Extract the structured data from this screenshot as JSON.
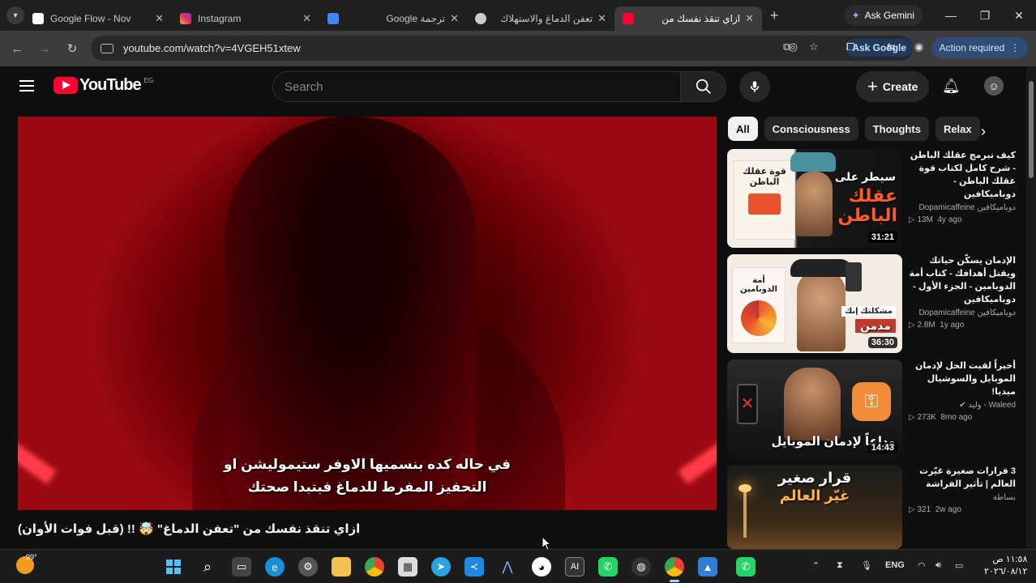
{
  "browser": {
    "tabs": [
      {
        "title": "Google Flow - Nov",
        "color": "#4285f4"
      },
      {
        "title": "Instagram",
        "color": "#e1306c"
      },
      {
        "title": "Google ترجمة",
        "color": "#4285f4"
      },
      {
        "title": "تعفن الدماغ والاستهلاك",
        "color": "#aaaaaa"
      },
      {
        "title": "ازاي تنقذ نفسك من",
        "color": "#ff0033",
        "active": true
      }
    ],
    "new_tab": "+",
    "ask_gemini": "Ask Gemini",
    "url": "youtube.com/watch?v=4VGEH51xtew",
    "ask_google": "Ask Google",
    "action_required": "Action required"
  },
  "youtube": {
    "logo_text": "YouTube",
    "country_code": "EG",
    "search_placeholder": "Search",
    "create_label": "Create",
    "video": {
      "subtitle_line1": "في حاله كده بنسميها الاوفر ستيموليشن او",
      "subtitle_line2": "التحفيز المفرط للدماغ فبتبدا صحتك",
      "title": "ازاي تنقذ نفسك من \"تعفن الدماغ\" 🤯 !! (قبل فوات الأوان)"
    },
    "chips": [
      "All",
      "Consciousness",
      "Thoughts",
      "Relax"
    ],
    "recommendations": [
      {
        "title": "كيف تبرمج عقلك الباطن - شرح كامل لكتاب قوة عقلك الباطن - دوباميكافين",
        "channel": "دوباميكافين Dopamicaffeine",
        "views": "13M",
        "age": "4y ago",
        "duration": "31:21",
        "thumb_text_1": "سيطر على",
        "thumb_text_2": "عقلك الباطن",
        "thumb_book": "قوة عقلك الباطن"
      },
      {
        "title": "الإدمان يسكّن حياتك ويقتل أهدافك - كتاب أمة الدوبامين - الجزء الأول - دوباميكافين",
        "channel": "دوباميكافين Dopamicaffeine",
        "views": "2.8M",
        "age": "1y ago",
        "duration": "36:30",
        "thumb_text_1": "مشكلتك إنك",
        "thumb_text_2": "مدمن",
        "thumb_book": "أمة الدوبامين"
      },
      {
        "title": "أخيراً لقيت الحل لإدمان الموبايل والسوشيال ميديا!",
        "channel": "Waleed - وليد",
        "views": "273K",
        "age": "8mo ago",
        "duration": "14:43",
        "thumb_text_1": "وداعاً لإدمان الموبايل"
      },
      {
        "title": "3 قرارات صغيرة غيّرت العالم | تأثير الفراشة",
        "channel": "بساطة",
        "views": "321",
        "age": "2w ago",
        "thumb_text_1": "قرار صغير",
        "thumb_text_2": "غيّر العالم"
      }
    ]
  },
  "taskbar": {
    "temp": "99°",
    "lang": "ENG",
    "time": "١١:٥٨ ص",
    "date": "٢٠٢٦/٠٨/١٢"
  }
}
